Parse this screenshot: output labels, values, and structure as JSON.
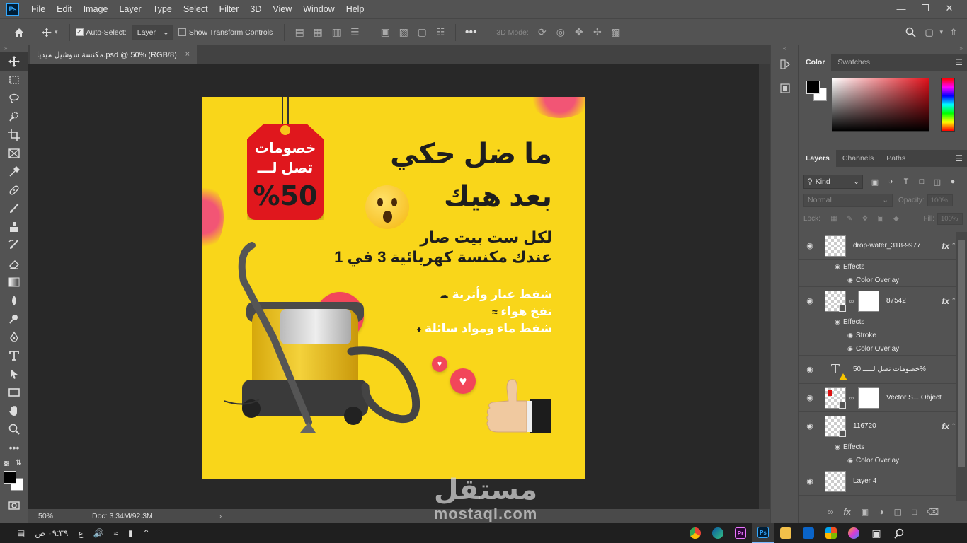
{
  "app": {
    "logo": "Ps",
    "menu": [
      "File",
      "Edit",
      "Image",
      "Layer",
      "Type",
      "Select",
      "Filter",
      "3D",
      "View",
      "Window",
      "Help"
    ],
    "window_controls": [
      "minimize",
      "restore",
      "close"
    ]
  },
  "options_bar": {
    "auto_select_label": "Auto-Select:",
    "auto_select_checked": true,
    "auto_select_target": "Layer",
    "transform_controls_label": "Show Transform Controls",
    "transform_controls_checked": false,
    "three_d_mode_label": "3D Mode:"
  },
  "document": {
    "tab_title": "مكنسة سوشيل ميديا.psd @ 50% (RGB/8)",
    "close_glyph": "×"
  },
  "status_bar": {
    "zoom": "50%",
    "doc_size": "Doc: 3.34M/92.3M",
    "arrow": "›"
  },
  "artboard": {
    "background": "#f9d61a",
    "tag": {
      "line1": "خصومات",
      "line2": "تصل لـــ",
      "line3": "%50",
      "color": "#e0171d"
    },
    "headline_1": "ما ضل حكي",
    "headline_2": "بعد هيك",
    "sub_1": "لكل ست بيت صار",
    "sub_2": "عندك مكنسة كهربائية 3 في 1",
    "features": [
      "شفط غبار وأتربة",
      "نفخ هواء",
      "شفط ماء ومواد سائلة"
    ],
    "feature_icons": [
      "dust-icon",
      "wind-icon",
      "water-drop-icon"
    ]
  },
  "color_panel": {
    "tabs": [
      "Color",
      "Swatches"
    ],
    "active_tab": "Color",
    "foreground": "#000000",
    "background": "#ffffff"
  },
  "layers_panel": {
    "tabs": [
      "Layers",
      "Channels",
      "Paths"
    ],
    "active_tab": "Layers",
    "filter_kind": "Kind",
    "blend_mode": "Normal",
    "opacity_label": "Opacity:",
    "opacity_value": "100%",
    "lock_label": "Lock:",
    "fill_label": "Fill:",
    "fill_value": "100%",
    "effects_label": "Effects",
    "fx_label": "fx",
    "layers": [
      {
        "name": "drop-water_318-9977",
        "fx": true,
        "effects": [
          "Color Overlay"
        ]
      },
      {
        "name": "87542",
        "fx": true,
        "mask": true,
        "effects": [
          "Stroke",
          "Color Overlay"
        ]
      },
      {
        "name": "خصومات تصل لـــــ 50%",
        "type": "text",
        "warning": true
      },
      {
        "name": "Vector S... Object",
        "mask": true,
        "smart": true
      },
      {
        "name": "116720",
        "fx": true,
        "smart": true,
        "effects": [
          "Color Overlay"
        ]
      },
      {
        "name": "Layer 4"
      }
    ]
  },
  "taskbar": {
    "time": "٠٩:٣٩ ص",
    "lang": "ع",
    "apps": [
      "chrome",
      "edge",
      "premiere",
      "photoshop",
      "files",
      "outlook",
      "store",
      "copilot",
      "task-view",
      "search"
    ],
    "app_labels": {
      "premiere": "Pr",
      "photoshop": "Ps"
    },
    "active_app": "photoshop"
  },
  "watermark": {
    "arabic": "مستقل",
    "latin": "mostaql.com"
  }
}
